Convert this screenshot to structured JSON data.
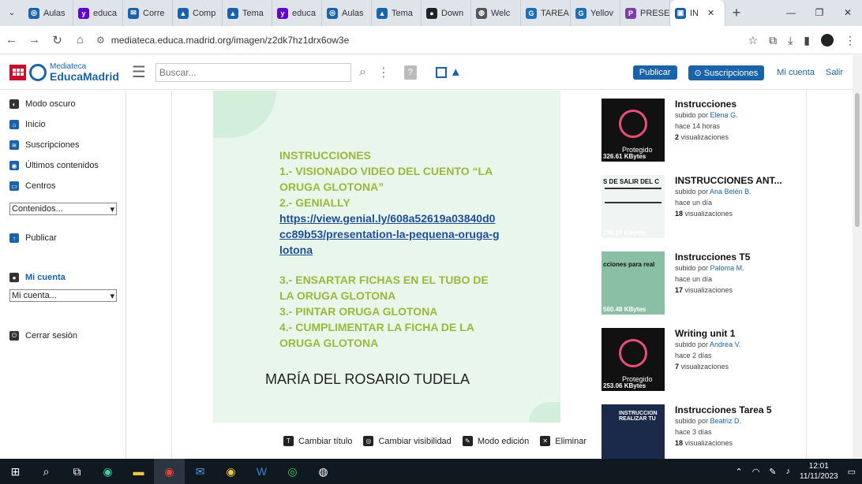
{
  "browser": {
    "tabs": [
      {
        "label": "Aulas",
        "icon": "aulas-icon",
        "color": "#1a63a8"
      },
      {
        "label": "educa",
        "icon": "yahoo-icon",
        "color": "#6001d2"
      },
      {
        "label": "Corre",
        "icon": "mail-icon",
        "color": "#1a63a8"
      },
      {
        "label": "Comp",
        "icon": "graduation-cap-icon",
        "color": "#1a63a8"
      },
      {
        "label": "Tema",
        "icon": "graduation-cap-icon",
        "color": "#1a63a8"
      },
      {
        "label": "educa",
        "icon": "yahoo-icon",
        "color": "#6001d2"
      },
      {
        "label": "Aulas",
        "icon": "aulas-icon",
        "color": "#1a63a8"
      },
      {
        "label": "Tema",
        "icon": "graduation-cap-icon",
        "color": "#1a63a8"
      },
      {
        "label": "Down",
        "icon": "download-site-icon",
        "color": "#222"
      },
      {
        "label": "Welc",
        "icon": "globe-icon",
        "color": "#555"
      },
      {
        "label": "TAREA",
        "icon": "genially-icon",
        "color": "#1d6fb8"
      },
      {
        "label": "Yellov",
        "icon": "genially-icon",
        "color": "#1d6fb8"
      },
      {
        "label": "PRESE",
        "icon": "presentation-icon",
        "color": "#7b3fa6"
      }
    ],
    "active_tab": {
      "label": "IN",
      "icon": "mediateca-icon",
      "color": "#1a63a8"
    },
    "url": "mediateca.educa.madrid.org/imagen/z2dk7hz1drx6ow3e"
  },
  "header": {
    "logo_small": "Mediateca",
    "logo_big": "EducaMadrid",
    "search_placeholder": "Buscar...",
    "publish_label": "Publicar",
    "subscriptions_label": "Suscripciones",
    "account_label": "Mi cuenta",
    "logout_label": "Salir"
  },
  "sidebar": {
    "items": [
      {
        "label": "Modo oscuro",
        "icon": "dark-mode-icon"
      },
      {
        "label": "Inicio",
        "icon": "home-icon"
      },
      {
        "label": "Suscripciones",
        "icon": "rss-icon"
      },
      {
        "label": "Últimos contenidos",
        "icon": "latest-icon"
      },
      {
        "label": "Centros",
        "icon": "school-icon"
      }
    ],
    "contents_select": "Contenidos...",
    "publish_label": "Publicar",
    "account_title": "Mi cuenta",
    "account_select": "Mi cuenta...",
    "logout_label": "Cerrar sesión"
  },
  "image": {
    "lines": [
      "INSTRUCCIONES",
      "1.- VISIONADO VIDEO DEL CUENTO “LA ORUGA GLOTONA”",
      "2.- GENIALLY"
    ],
    "link": "https://view.genial.ly/608a52619a03840d0cc89b53/presentation-la-pequena-oruga-glotona",
    "lines2": [
      "3.- ENSARTAR FICHAS EN EL TUBO DE LA ORUGA GLOTONA",
      "3.- PINTAR ORUGA GLOTONA",
      "4.- CUMPLIMENTAR LA FICHA DE LA ORUGA GLOTONA"
    ],
    "author": "MARÍA DEL ROSARIO TUDELA"
  },
  "actions": {
    "change_title": "Cambiar título",
    "change_visibility": "Cambiar visibilidad",
    "edit_mode": "Modo edición",
    "delete": "Eliminar"
  },
  "related": [
    {
      "title": "Instrucciones",
      "uploaded_by": "subido por",
      "user": "Elena G.",
      "when": "hace 14 horas",
      "views_count": "2",
      "views_label": "visualizaciones",
      "size": "326.61 KBytes",
      "thumb_label": "Protegido"
    },
    {
      "title": "INSTRUCCIONES ANT...",
      "uploaded_by": "subido por",
      "user": "Ana Belén B.",
      "when": "hace un día",
      "views_count": "18",
      "views_label": "visualizaciones",
      "size": "288.37 KBytes",
      "thumb_text": "S DE SALIR DEL C"
    },
    {
      "title": "Instrucciones T5",
      "uploaded_by": "subido por",
      "user": "Paloma M.",
      "when": "hace un día",
      "views_count": "17",
      "views_label": "visualizaciones",
      "size": "560.48 KBytes",
      "thumb_text": "cciones para real"
    },
    {
      "title": "Writing unit 1",
      "uploaded_by": "subido por",
      "user": "Andrea V.",
      "when": "hace 2 días",
      "views_count": "7",
      "views_label": "visualizaciones",
      "size": "253.06 KBytes",
      "thumb_label": "Protegido"
    },
    {
      "title": "Instrucciones Tarea 5",
      "uploaded_by": "subido por",
      "user": "Beatriz D.",
      "when": "hace 3 días",
      "views_count": "18",
      "views_label": "visualizaciones",
      "size": "",
      "thumb_text": "INSTRUCCION REALIZAR TU"
    }
  ],
  "taskbar": {
    "time": "12:01",
    "date": "11/11/2023"
  }
}
